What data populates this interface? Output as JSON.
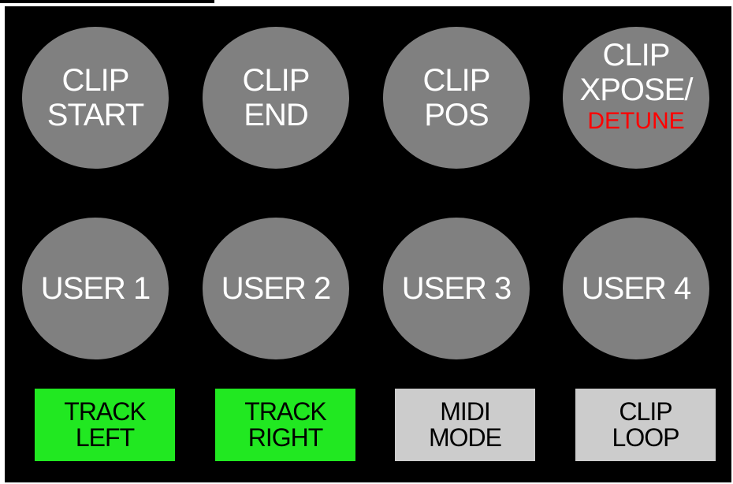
{
  "colors": {
    "panel_bg": "#000000",
    "knob_fill": "#808080",
    "knob_text": "#ffffff",
    "detune_text": "#ff0000",
    "track_button": "#21e821",
    "mode_button": "#cccccc"
  },
  "knobs_top": [
    {
      "line1": "CLIP",
      "line2": "START"
    },
    {
      "line1": "CLIP",
      "line2": "END"
    },
    {
      "line1": "CLIP",
      "line2": "POS"
    },
    {
      "line1": "CLIP",
      "line2": "XPOSE/",
      "line3": "DETUNE"
    }
  ],
  "knobs_user": [
    {
      "label": "USER 1"
    },
    {
      "label": "USER 2"
    },
    {
      "label": "USER 3"
    },
    {
      "label": "USER 4"
    }
  ],
  "buttons": [
    {
      "line1": "TRACK",
      "line2": "LEFT"
    },
    {
      "line1": "TRACK",
      "line2": "RIGHT"
    },
    {
      "line1": "MIDI",
      "line2": "MODE"
    },
    {
      "line1": "CLIP",
      "line2": "LOOP"
    }
  ]
}
